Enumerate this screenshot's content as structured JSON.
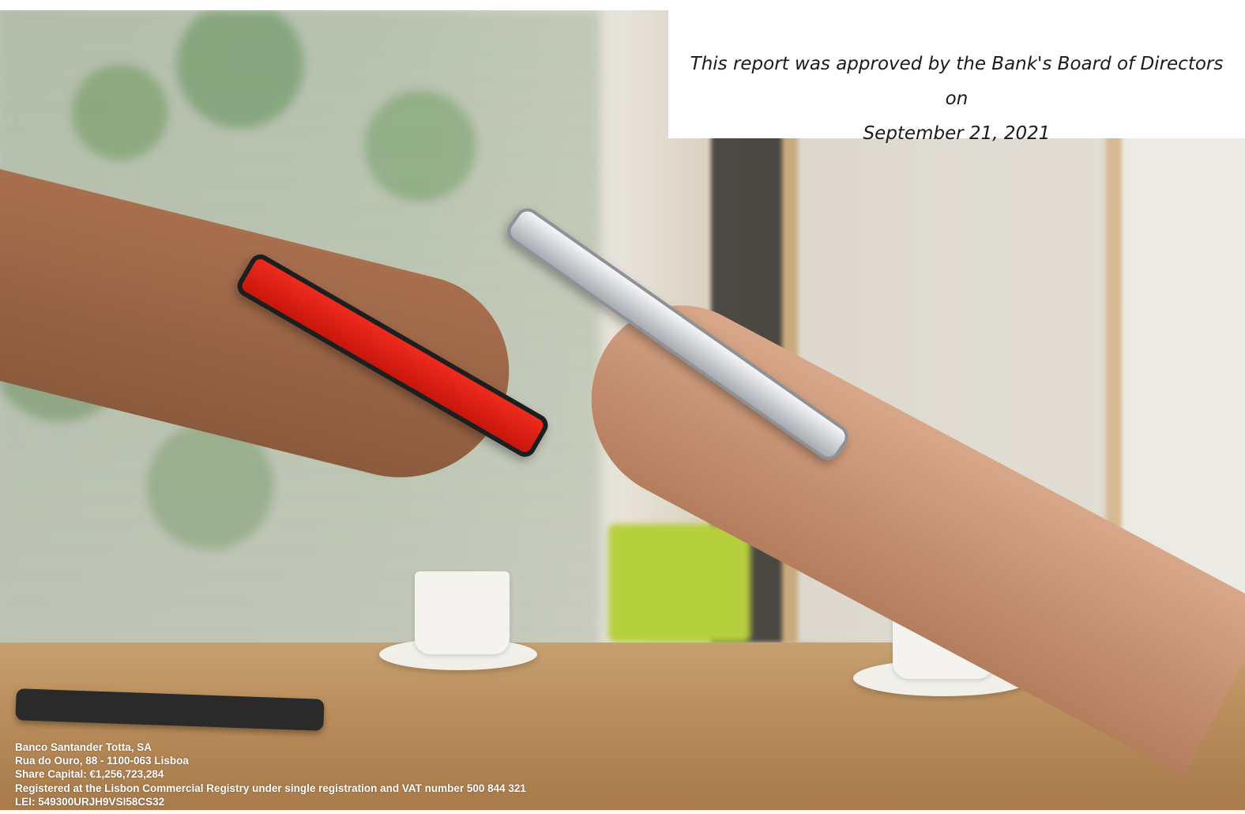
{
  "approval_note": {
    "line1": "This report was approved by the Bank's Board of Directors on",
    "line2": "September 21, 2021"
  },
  "corporate_info": {
    "company": "Banco Santander Totta, SA",
    "address": "Rua do Ouro, 88 - 1100-063 Lisboa",
    "share_capital": "Share Capital: €1,256,723,284",
    "registration": "Registered at the Lisbon Commercial Registry under single registration and VAT number 500 844 321",
    "lei": "LEI: 549300URJH9VSI58CS32"
  },
  "colors": {
    "brand_red": "#ec0000",
    "text_dark": "#1a1a1a",
    "footer_text": "#ffffff"
  }
}
